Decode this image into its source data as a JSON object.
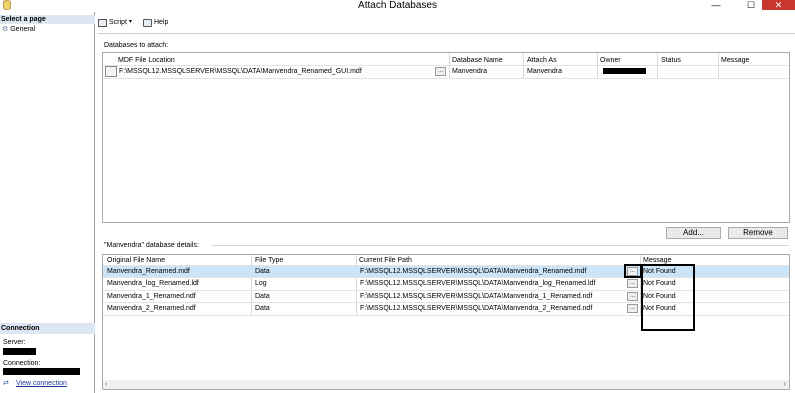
{
  "window": {
    "title": "Attach Databases",
    "minimize": "—",
    "maximize": "☐",
    "close": "✕"
  },
  "left_pane": {
    "select_header": "Select a page",
    "pages": [
      {
        "label": "General"
      }
    ],
    "connection_header": "Connection",
    "server_label": "Server:",
    "connection_label": "Connection:",
    "view_connection": "View connection"
  },
  "toolbar": {
    "script": "Script",
    "help": "Help"
  },
  "attach": {
    "section_label": "Databases to attach:",
    "columns": [
      "MDF File Location",
      "Database Name",
      "Attach As",
      "Owner",
      "Status",
      "Message"
    ],
    "rows": [
      {
        "mdf": "F:\\MSSQL12.MSSQLSERVER\\MSSQL\\DATA\\Manvendra_Renamed_GUI.mdf",
        "browse": "...",
        "db_name": "Manvendra",
        "attach_as": "Manvendra",
        "owner": "",
        "status": "",
        "message": ""
      }
    ],
    "add_button": "Add...",
    "remove_button": "Remove"
  },
  "details": {
    "section_label": "\"Manvendra\" database details:",
    "columns": [
      "Original File Name",
      "File Type",
      "Current File Path",
      "Message"
    ],
    "rows": [
      {
        "name": "Manvendra_Renamed.mdf",
        "type": "Data",
        "path": "F:\\MSSQL12.MSSQLSERVER\\MSSQL\\DATA\\Manvendra_Renamed.mdf",
        "browse": "...",
        "message": "Not Found"
      },
      {
        "name": "Manvendra_log_Renamed.ldf",
        "type": "Log",
        "path": "F:\\MSSQL12.MSSQLSERVER\\MSSQL\\DATA\\Manvendra_log_Renamed.ldf",
        "browse": "...",
        "message": "Not Found"
      },
      {
        "name": "Manvendra_1_Renamed.ndf",
        "type": "Data",
        "path": "F:\\MSSQL12.MSSQLSERVER\\MSSQL\\DATA\\Manvendra_1_Renamed.ndf",
        "browse": "...",
        "message": "Not Found"
      },
      {
        "name": "Manvendra_2_Renamed.ndf",
        "type": "Data",
        "path": "F:\\MSSQL12.MSSQLSERVER\\MSSQL\\DATA\\Manvendra_2_Renamed.ndf",
        "browse": "...",
        "message": "Not Found"
      }
    ]
  },
  "colors": {
    "close_button": "#c7372f",
    "header_bg": "#dde6f3",
    "selected_row": "#cce4f7"
  }
}
